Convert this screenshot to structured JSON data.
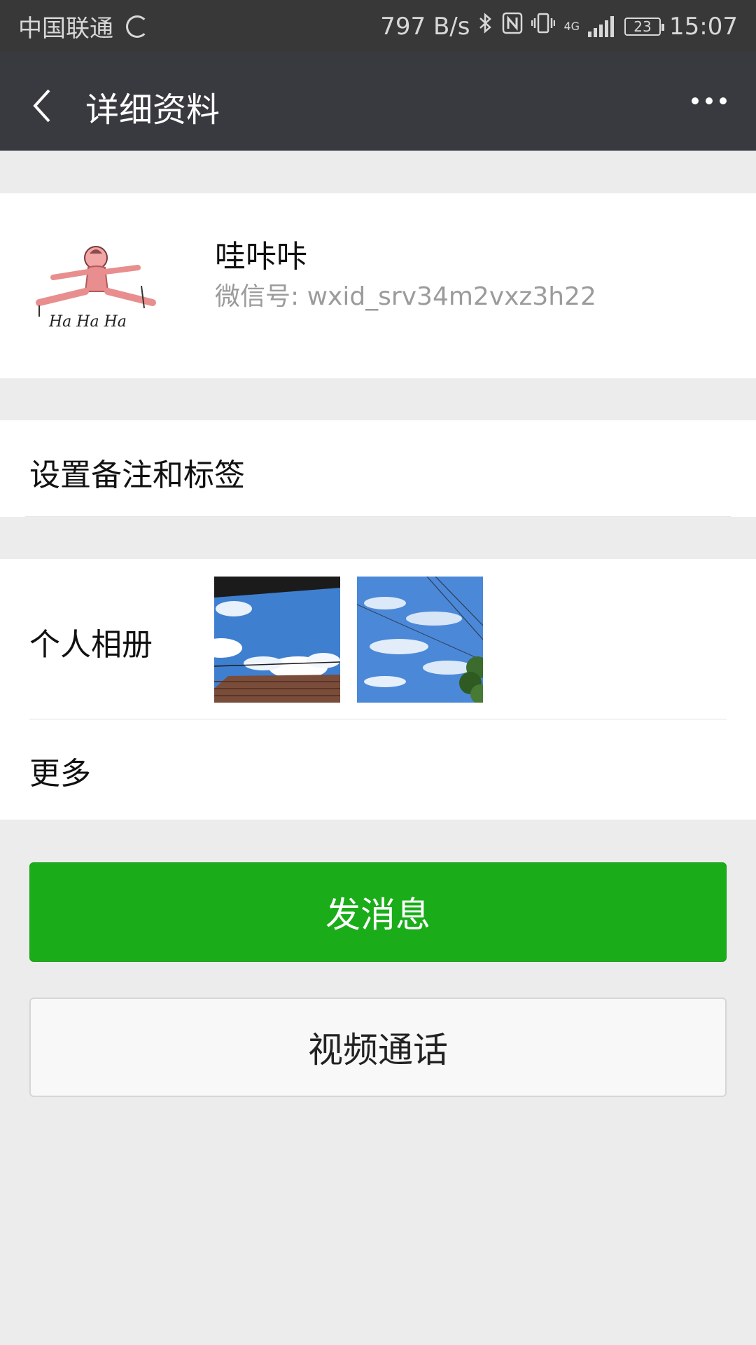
{
  "status_bar": {
    "carrier": "中国联通",
    "net_speed": "797 B/s",
    "network": "4G",
    "battery": "23",
    "time": "15:07"
  },
  "nav": {
    "title": "详细资料"
  },
  "profile": {
    "name": "哇咔咔",
    "wechat_id": "微信号: wxid_srv34m2vxz3h22",
    "avatar_caption": "Ha Ha Ha"
  },
  "rows": {
    "remark_label": "设置备注和标签",
    "album_label": "个人相册",
    "more_label": "更多"
  },
  "buttons": {
    "send_message": "发消息",
    "video_call": "视频通话"
  },
  "colors": {
    "header_bg": "#393a3f",
    "status_bg": "#383838",
    "primary_green": "#1aad19",
    "page_bg": "#ececec"
  }
}
